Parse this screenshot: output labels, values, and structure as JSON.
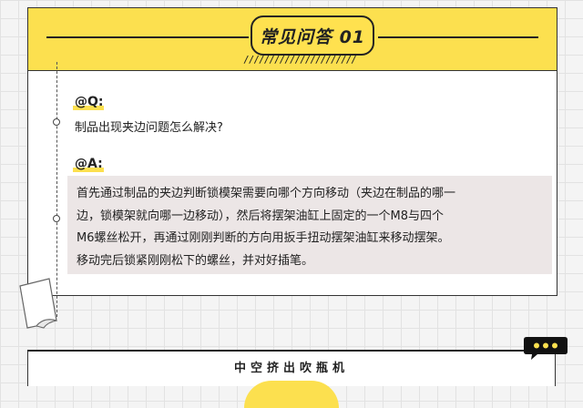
{
  "header": {
    "title": "常见问答 01",
    "decoration": "//////////////////////"
  },
  "qa": {
    "q_label": "@Q:",
    "question": "制品出现夹边问题怎么解决?",
    "a_label": "@A:",
    "answer_lines": [
      "首先通过制品的夹边判断锁模架需要向哪个方向移动（夹边在制品的哪一",
      "边，锁模架就向哪一边移动），然后将摆架油缸上固定的一个M8与四个",
      "M6螺丝松开，再通过刚刚判断的方向用扳手扭动摆架油缸来移动摆架。",
      "移动完后锁紧刚刚松下的螺丝，并对好插笔。"
    ]
  },
  "footer": {
    "title": "中空挤出吹瓶机"
  },
  "icons": {
    "chat": "chat-bubble-icon",
    "paper": "curled-paper-icon"
  },
  "colors": {
    "accent": "#fce04f",
    "answer_bg": "#ece6e6",
    "ink": "#222222"
  }
}
